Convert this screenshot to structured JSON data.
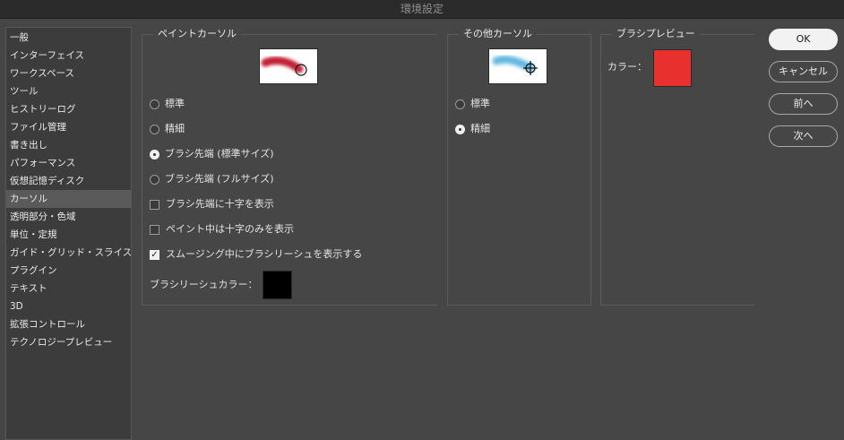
{
  "window": {
    "title": "環境設定"
  },
  "sidebar": {
    "items": [
      {
        "label": "一般"
      },
      {
        "label": "インターフェイス"
      },
      {
        "label": "ワークスペース"
      },
      {
        "label": "ツール"
      },
      {
        "label": "ヒストリーログ"
      },
      {
        "label": "ファイル管理"
      },
      {
        "label": "書き出し"
      },
      {
        "label": "パフォーマンス"
      },
      {
        "label": "仮想記憶ディスク"
      },
      {
        "label": "カーソル",
        "selected": true
      },
      {
        "label": "透明部分・色域"
      },
      {
        "label": "単位・定規"
      },
      {
        "label": "ガイド・グリッド・スライス"
      },
      {
        "label": "プラグイン"
      },
      {
        "label": "テキスト"
      },
      {
        "label": "3D"
      },
      {
        "label": "拡張コントロール"
      },
      {
        "label": "テクノロジープレビュー"
      }
    ]
  },
  "paint_cursors": {
    "title": "ペイントカーソル",
    "options": {
      "standard": "標準",
      "precise": "精細",
      "brush_normal": "ブラシ先端 (標準サイズ)",
      "brush_full": "ブラシ先端 (フルサイズ)"
    },
    "selected": "brush_normal",
    "checkboxes": {
      "crosshair_in_tip": "ブラシ先端に十字を表示",
      "crosshair_only": "ペイント中は十字のみを表示",
      "leash_smoothing": "スムージング中にブラシリーシュを表示する"
    },
    "checked": {
      "crosshair_in_tip": false,
      "crosshair_only": false,
      "leash_smoothing": true
    },
    "leash_color_label": "ブラシリーシュカラー：",
    "leash_color": "#000000",
    "preview_stroke_color": "#c0182c"
  },
  "other_cursors": {
    "title": "その他カーソル",
    "options": {
      "standard": "標準",
      "precise": "精細"
    },
    "selected": "precise",
    "preview_stroke_color": "#5ab4e0"
  },
  "brush_preview": {
    "title": "ブラシプレビュー",
    "color_label": "カラー：",
    "color": "#e8312f"
  },
  "buttons": {
    "ok": "OK",
    "cancel": "キャンセル",
    "prev": "前へ",
    "next": "次へ"
  }
}
